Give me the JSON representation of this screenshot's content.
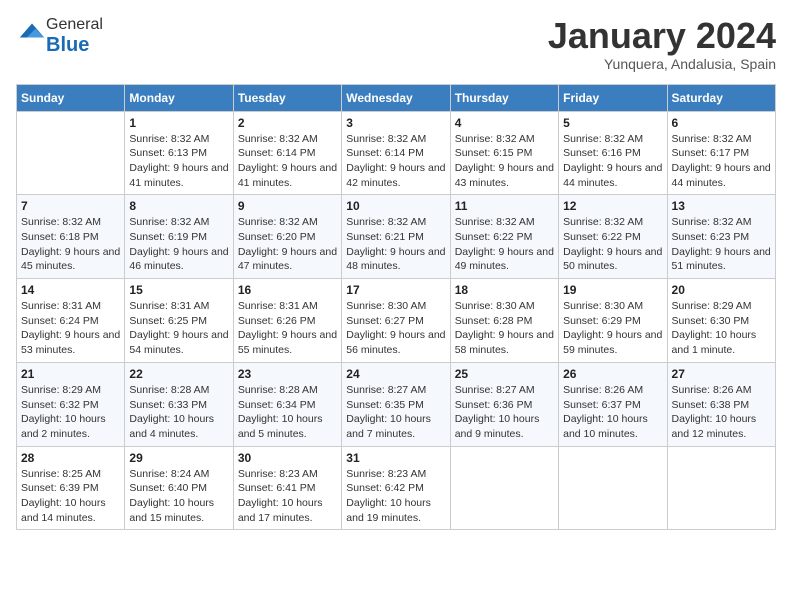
{
  "logo": {
    "general": "General",
    "blue": "Blue"
  },
  "header": {
    "month": "January 2024",
    "location": "Yunquera, Andalusia, Spain"
  },
  "weekdays": [
    "Sunday",
    "Monday",
    "Tuesday",
    "Wednesday",
    "Thursday",
    "Friday",
    "Saturday"
  ],
  "weeks": [
    [
      {
        "day": null,
        "info": null
      },
      {
        "day": "1",
        "sunrise": "8:32 AM",
        "sunset": "6:13 PM",
        "daylight": "9 hours and 41 minutes."
      },
      {
        "day": "2",
        "sunrise": "8:32 AM",
        "sunset": "6:14 PM",
        "daylight": "9 hours and 41 minutes."
      },
      {
        "day": "3",
        "sunrise": "8:32 AM",
        "sunset": "6:14 PM",
        "daylight": "9 hours and 42 minutes."
      },
      {
        "day": "4",
        "sunrise": "8:32 AM",
        "sunset": "6:15 PM",
        "daylight": "9 hours and 43 minutes."
      },
      {
        "day": "5",
        "sunrise": "8:32 AM",
        "sunset": "6:16 PM",
        "daylight": "9 hours and 44 minutes."
      },
      {
        "day": "6",
        "sunrise": "8:32 AM",
        "sunset": "6:17 PM",
        "daylight": "9 hours and 44 minutes."
      }
    ],
    [
      {
        "day": "7",
        "sunrise": "8:32 AM",
        "sunset": "6:18 PM",
        "daylight": "9 hours and 45 minutes."
      },
      {
        "day": "8",
        "sunrise": "8:32 AM",
        "sunset": "6:19 PM",
        "daylight": "9 hours and 46 minutes."
      },
      {
        "day": "9",
        "sunrise": "8:32 AM",
        "sunset": "6:20 PM",
        "daylight": "9 hours and 47 minutes."
      },
      {
        "day": "10",
        "sunrise": "8:32 AM",
        "sunset": "6:21 PM",
        "daylight": "9 hours and 48 minutes."
      },
      {
        "day": "11",
        "sunrise": "8:32 AM",
        "sunset": "6:22 PM",
        "daylight": "9 hours and 49 minutes."
      },
      {
        "day": "12",
        "sunrise": "8:32 AM",
        "sunset": "6:22 PM",
        "daylight": "9 hours and 50 minutes."
      },
      {
        "day": "13",
        "sunrise": "8:32 AM",
        "sunset": "6:23 PM",
        "daylight": "9 hours and 51 minutes."
      }
    ],
    [
      {
        "day": "14",
        "sunrise": "8:31 AM",
        "sunset": "6:24 PM",
        "daylight": "9 hours and 53 minutes."
      },
      {
        "day": "15",
        "sunrise": "8:31 AM",
        "sunset": "6:25 PM",
        "daylight": "9 hours and 54 minutes."
      },
      {
        "day": "16",
        "sunrise": "8:31 AM",
        "sunset": "6:26 PM",
        "daylight": "9 hours and 55 minutes."
      },
      {
        "day": "17",
        "sunrise": "8:30 AM",
        "sunset": "6:27 PM",
        "daylight": "9 hours and 56 minutes."
      },
      {
        "day": "18",
        "sunrise": "8:30 AM",
        "sunset": "6:28 PM",
        "daylight": "9 hours and 58 minutes."
      },
      {
        "day": "19",
        "sunrise": "8:30 AM",
        "sunset": "6:29 PM",
        "daylight": "9 hours and 59 minutes."
      },
      {
        "day": "20",
        "sunrise": "8:29 AM",
        "sunset": "6:30 PM",
        "daylight": "10 hours and 1 minute."
      }
    ],
    [
      {
        "day": "21",
        "sunrise": "8:29 AM",
        "sunset": "6:32 PM",
        "daylight": "10 hours and 2 minutes."
      },
      {
        "day": "22",
        "sunrise": "8:28 AM",
        "sunset": "6:33 PM",
        "daylight": "10 hours and 4 minutes."
      },
      {
        "day": "23",
        "sunrise": "8:28 AM",
        "sunset": "6:34 PM",
        "daylight": "10 hours and 5 minutes."
      },
      {
        "day": "24",
        "sunrise": "8:27 AM",
        "sunset": "6:35 PM",
        "daylight": "10 hours and 7 minutes."
      },
      {
        "day": "25",
        "sunrise": "8:27 AM",
        "sunset": "6:36 PM",
        "daylight": "10 hours and 9 minutes."
      },
      {
        "day": "26",
        "sunrise": "8:26 AM",
        "sunset": "6:37 PM",
        "daylight": "10 hours and 10 minutes."
      },
      {
        "day": "27",
        "sunrise": "8:26 AM",
        "sunset": "6:38 PM",
        "daylight": "10 hours and 12 minutes."
      }
    ],
    [
      {
        "day": "28",
        "sunrise": "8:25 AM",
        "sunset": "6:39 PM",
        "daylight": "10 hours and 14 minutes."
      },
      {
        "day": "29",
        "sunrise": "8:24 AM",
        "sunset": "6:40 PM",
        "daylight": "10 hours and 15 minutes."
      },
      {
        "day": "30",
        "sunrise": "8:23 AM",
        "sunset": "6:41 PM",
        "daylight": "10 hours and 17 minutes."
      },
      {
        "day": "31",
        "sunrise": "8:23 AM",
        "sunset": "6:42 PM",
        "daylight": "10 hours and 19 minutes."
      },
      {
        "day": null,
        "info": null
      },
      {
        "day": null,
        "info": null
      },
      {
        "day": null,
        "info": null
      }
    ]
  ],
  "labels": {
    "sunrise": "Sunrise:",
    "sunset": "Sunset:",
    "daylight": "Daylight:"
  }
}
